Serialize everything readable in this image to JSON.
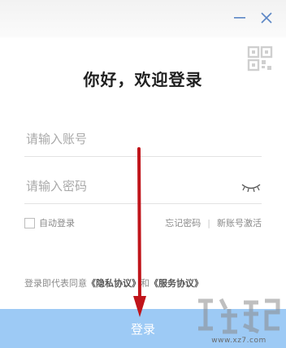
{
  "window": {
    "minimize_icon": "minimize-icon",
    "close_icon": "close-icon",
    "qr_icon": "qr-code-icon"
  },
  "login": {
    "title": "你好，欢迎登录",
    "account_placeholder": "请输入账号",
    "password_placeholder": "请输入密码",
    "auto_login": "自动登录",
    "forgot_password": "忘记密码",
    "separator": "|",
    "new_account": "新账号激活",
    "agreement_prefix": "登录即代表同意",
    "privacy": "《隐私协议》",
    "and": "和",
    "service": "《服务协议》",
    "button": "登录"
  },
  "watermark": {
    "text": "www.xz7.com"
  },
  "colors": {
    "button": "#9dcaf5",
    "accent_icon": "#5b86c5",
    "arrow": "#c0141a"
  }
}
